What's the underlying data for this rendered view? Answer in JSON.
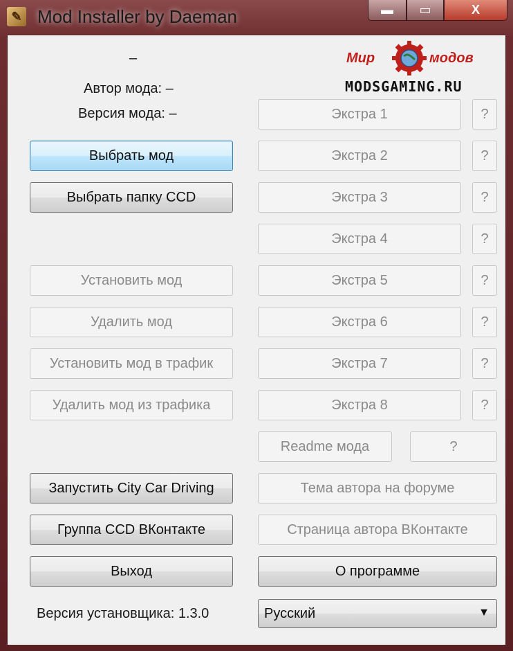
{
  "window": {
    "title": "Mod Installer by Daeman",
    "controls": {
      "minimize": "▬",
      "maximize": "▭",
      "close": "X"
    }
  },
  "mod_info": {
    "name": "–",
    "author_label": "Автор мода: –",
    "version_label": "Версия мода: –"
  },
  "logo": {
    "word_left": "Мир",
    "word_right": "модов",
    "site": "MODSGAMING.RU"
  },
  "left_buttons": {
    "select_mod": "Выбрать мод",
    "select_ccd_folder": "Выбрать папку CCD",
    "install_mod": "Установить мод",
    "remove_mod": "Удалить мод",
    "install_mod_traffic": "Установить мод в трафик",
    "remove_mod_traffic": "Удалить мод из трафика",
    "launch_game": "Запустить City Car Driving",
    "vk_group": "Группа CCD ВКонтакте",
    "exit": "Выход"
  },
  "extras": [
    {
      "label": "Экстра 1",
      "help": "?"
    },
    {
      "label": "Экстра 2",
      "help": "?"
    },
    {
      "label": "Экстра 3",
      "help": "?"
    },
    {
      "label": "Экстра 4",
      "help": "?"
    },
    {
      "label": "Экстра 5",
      "help": "?"
    },
    {
      "label": "Экстра 6",
      "help": "?"
    },
    {
      "label": "Экстра 7",
      "help": "?"
    },
    {
      "label": "Экстра 8",
      "help": "?"
    }
  ],
  "right_buttons": {
    "readme": "Readme мода",
    "readme_help": "?",
    "author_forum": "Тема автора на форуме",
    "author_vk": "Страница автора ВКонтакте",
    "about": "О программе"
  },
  "footer": {
    "installer_version": "Версия установщика: 1.3.0",
    "language_selected": "Русский"
  }
}
